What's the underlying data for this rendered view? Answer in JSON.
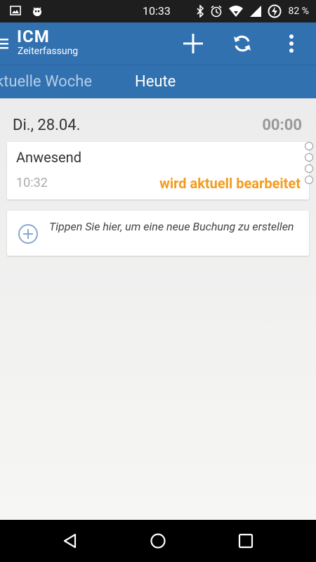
{
  "status_bar": {
    "time": "10:33",
    "battery_percent": "82 %",
    "icons": [
      "image-icon",
      "notification-bug-icon",
      "bluetooth-icon",
      "alarm-icon",
      "wifi-icon",
      "signal-icon",
      "battery-charging-icon"
    ]
  },
  "app_bar": {
    "title": "ICM",
    "subtitle": "Zeiterfassung",
    "actions": [
      "add-icon",
      "sync-icon",
      "overflow-menu-icon"
    ],
    "color": "#3271b0"
  },
  "tabs": [
    {
      "label": "ktuelle Woche",
      "active": false
    },
    {
      "label": "Heute",
      "active": true
    }
  ],
  "day": {
    "date": "Di., 28.04.",
    "total": "00:00"
  },
  "entry": {
    "title": "Anwesend",
    "time": "10:32",
    "status": "wird aktuell bearbeitet",
    "status_color": "#f39c1f"
  },
  "add_booking": {
    "text": "Tippen Sie hier, um eine neue Buchung zu erstellen"
  },
  "nav_bar": {
    "buttons": [
      "back-icon",
      "home-icon",
      "recents-icon"
    ]
  }
}
